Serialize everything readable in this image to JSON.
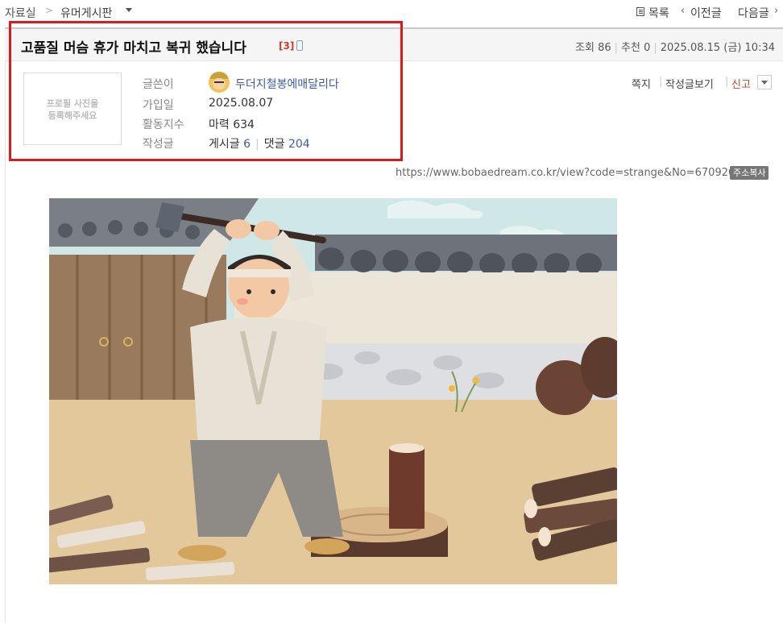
{
  "breadcrumb": {
    "root": "자료실",
    "separator": ">",
    "board": "유머게시판"
  },
  "nav": {
    "list": "목록",
    "prev": "이전글",
    "next": "다음글",
    "prev_arrow": "‹",
    "next_arrow": "›"
  },
  "post": {
    "title": "고품질 머슴 휴가 마치고 복귀 했습니다",
    "comment_count": "[3]",
    "views_label": "조회",
    "views": "86",
    "likes_label": "추천",
    "likes": "0",
    "date": "2025.08.15 (금) 10:34"
  },
  "profile": {
    "placeholder": "프로필 사진을\n등록해주세요"
  },
  "author": {
    "writer_label": "글쓴이",
    "name": "두더지철봉에매달리다",
    "joined_label": "가입일",
    "joined": "2025.08.07",
    "activity_label": "활동지수",
    "activity_prefix": "마력",
    "activity": "634",
    "writings_label": "작성글",
    "posts_label": "게시글",
    "posts": "6",
    "comments_label": "댓글",
    "comments": "204"
  },
  "actions": {
    "message": "쪽지",
    "view_posts": "작성글보기",
    "report": "신고"
  },
  "url": {
    "text": "https://www.bobaedream.co.kr/view?code=strange&No=6709266",
    "copy": "주소복사"
  },
  "colors": {
    "highlight": "#e0181b",
    "link": "#3b5ba9",
    "report": "#d83a2a"
  },
  "icons": [
    "list-icon",
    "mobile-icon",
    "avatar",
    "chevron-down-icon"
  ]
}
